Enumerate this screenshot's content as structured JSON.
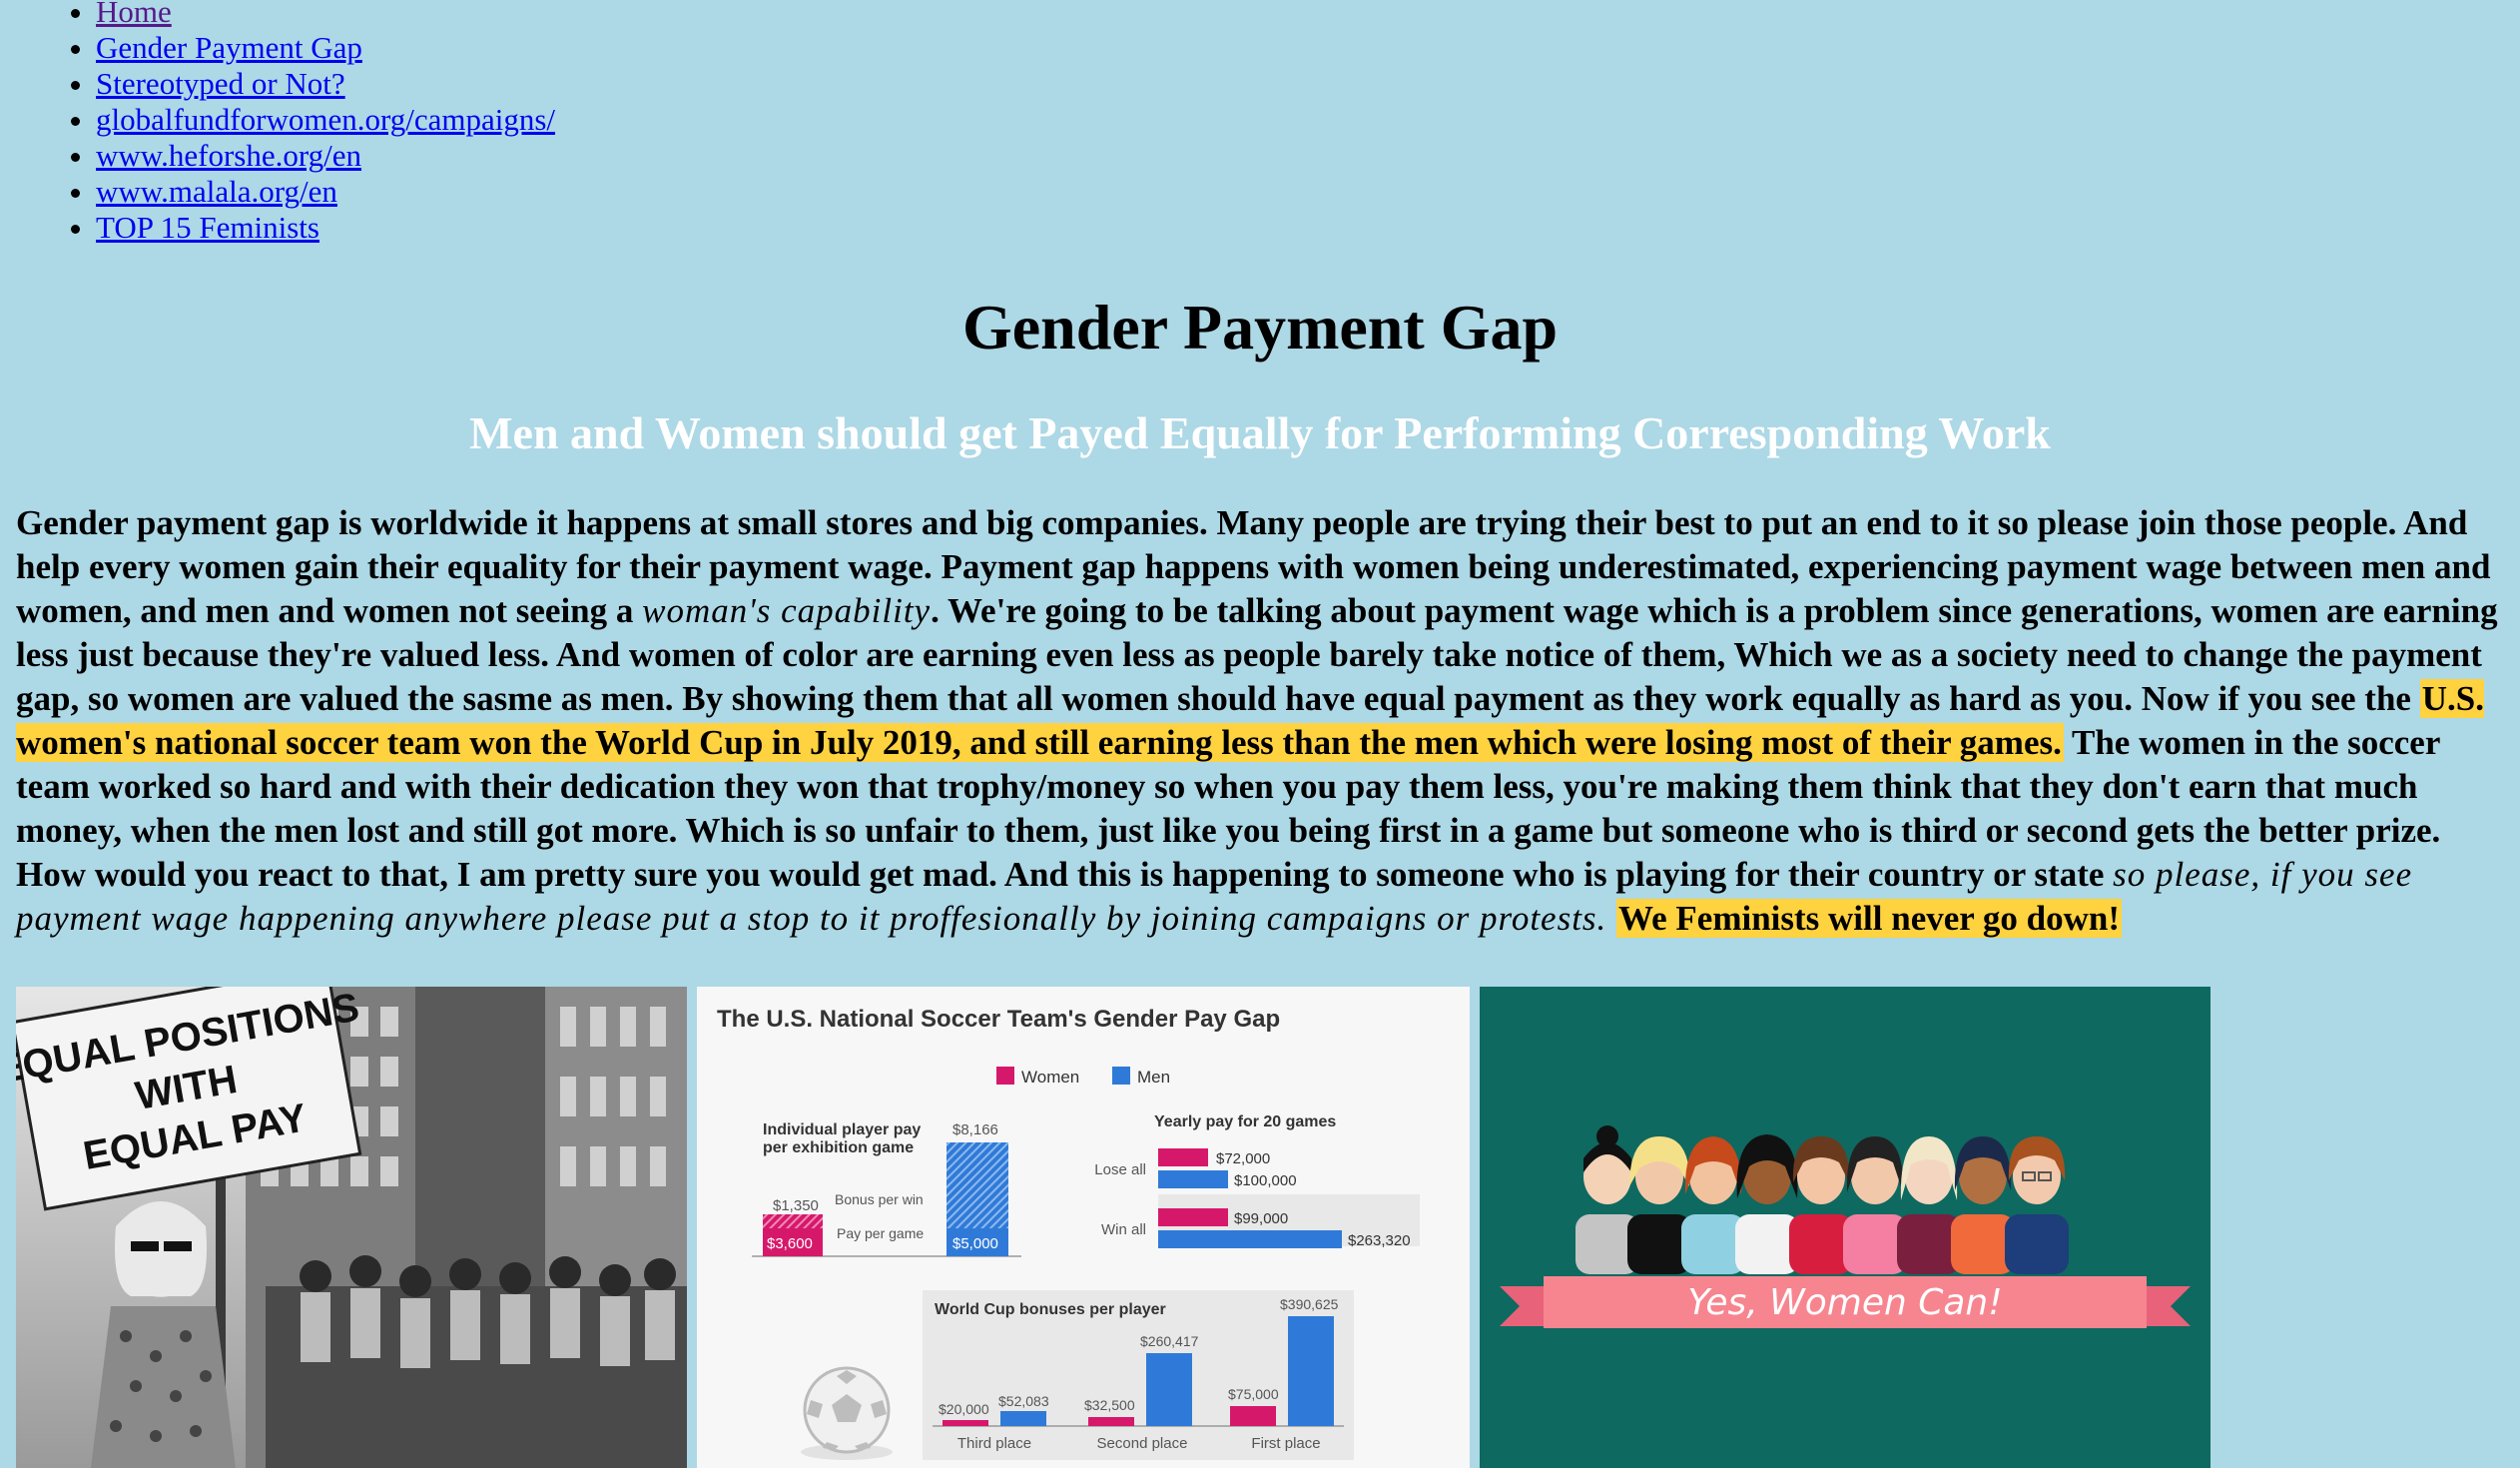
{
  "nav": [
    {
      "label": "Home"
    },
    {
      "label": "Gender Payment Gap"
    },
    {
      "label": "Stereotyped or Not?"
    },
    {
      "label": "globalfundforwomen.org/campaigns/"
    },
    {
      "label": "www.heforshe.org/en"
    },
    {
      "label": "www.malala.org/en"
    },
    {
      "label": "TOP 15 Feminists"
    }
  ],
  "title": "Gender Payment Gap",
  "subtitle": "Men and Women should get Payed Equally for Performing Corresponding Work",
  "paragraph": {
    "p1": "Gender payment gap is worldwide it happens at small stores and big companies. Many people are trying their best to put an end to it so please join those people. And help every women gain their equality for their payment wage. Payment gap happens with women being underestimated, experiencing payment wage between men and women, and men and women not seeing a ",
    "p1_italic": "woman's capability",
    "p2": ". We're going to be talking about payment wage which is a problem since generations, women are earning less just because they're valued less. And women of color are earning even less as people barely take notice of them, Which we as a society need to change the payment gap, so women are valued the sasme as men. By showing them that all women should have equal payment as they work equally as hard as you. Now if you see the ",
    "highlight1": "U.S. women's national soccer team won the World Cup in July 2019, and still earning less than the men which were losing most of their games.",
    "p3": " The women in the soccer team worked so hard and with their dedication they won that trophy/money so when you pay them less, you're making them think that they don't earn that much money, when the men lost and still got more. Which is so unfair to them, just like you being first in a game but someone who is third or second gets the better prize. How would you react to that, I am pretty sure you would get mad. And this is happening to someone who is playing for their country or state ",
    "p3_italic": "so please, if you see payment wage happening anywhere please put a stop to it proffesionally by joining campaigns or protests",
    "p4": ". ",
    "highlight2": "We Feminists will never go down!"
  },
  "protest_sign": [
    "EQUAL POSITIONS",
    "WITH",
    "EQUAL PAY"
  ],
  "chart": {
    "title": "The U.S. National Soccer Team's Gender Pay Gap",
    "legend": [
      "Women",
      "Men"
    ],
    "colors": {
      "women": "#d6186b",
      "men": "#2f7ad8"
    },
    "panel1": {
      "title_line1": "Individual player pay",
      "title_line2": "per exhibition game",
      "women": {
        "bonus": "$1,350",
        "pay": "$3,600"
      },
      "men": {
        "bonus": "$8,166",
        "pay": "$5,000"
      },
      "bonus_label": "Bonus per win",
      "pay_label": "Pay per game"
    },
    "panel2": {
      "title": "Yearly pay for 20 games",
      "rows": [
        {
          "label": "Lose all",
          "women": "$72,000",
          "men": "$100,000"
        },
        {
          "label": "Win all",
          "women": "$99,000",
          "men": "$263,320"
        }
      ]
    },
    "panel3": {
      "title": "World Cup bonuses per player",
      "groups": [
        {
          "label": "Third place",
          "women": "$20,000",
          "men": "$52,083"
        },
        {
          "label": "Second place",
          "women": "$32,500",
          "men": "$260,417"
        },
        {
          "label": "First place",
          "women": "$75,000",
          "men": "$390,625"
        }
      ]
    }
  },
  "banner": "Yes, Women Can!"
}
